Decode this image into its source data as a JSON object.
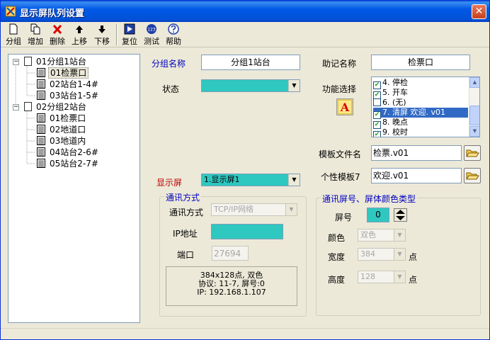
{
  "window": {
    "title": "显示屏队列设置",
    "close_glyph": "✕"
  },
  "toolbar": {
    "group": "分组",
    "add": "增加",
    "delete": "删除",
    "up": "上移",
    "down": "下移",
    "reset": "复位",
    "test": "测试",
    "help": "帮助",
    "test_badge": "123"
  },
  "tree": {
    "expander": "−",
    "groups": [
      {
        "label": "01分组1站台",
        "children": [
          "01检票口",
          "02站台1-4#",
          "03站台1-5#"
        ]
      },
      {
        "label": "02分组2站台",
        "children": [
          "01检票口",
          "02地道口",
          "03地道内",
          "04站台2-6#",
          "05站台2-7#"
        ]
      }
    ]
  },
  "form": {
    "group_name_label": "分组名称",
    "group_name_value": "分组1站台",
    "mnemonic_label": "助记名称",
    "mnemonic_value": "检票口",
    "status_label": "状态",
    "function_label": "功能选择",
    "function_items": [
      {
        "label": "4. 停检",
        "checked": true
      },
      {
        "label": "5. 开车",
        "checked": true
      },
      {
        "label": "6. (无)",
        "checked": false
      },
      {
        "label": "7. 清屏 欢迎. v01",
        "checked": true,
        "selected": true
      },
      {
        "label": "8. 晚点",
        "checked": true
      },
      {
        "label": "9. 校时",
        "checked": true
      }
    ],
    "font_icon_letter": "A",
    "template_file_label": "模板文件名",
    "template_file_value": "检票.v01",
    "personal_template_label": "个性模板7",
    "personal_template_value": "欢迎.v01",
    "display_label": "显示屏",
    "display_value": "1.显示屏1"
  },
  "comm": {
    "title": "通讯方式",
    "method_label": "通讯方式",
    "method_value": "TCP/IP网络",
    "ip_label": "IP地址",
    "port_label": "端口",
    "port_value": "27694",
    "info_lines": [
      "384x128点, 双色",
      "协议: 11-7, 屏号:0",
      "IP: 192.168.1.107"
    ]
  },
  "screen": {
    "title": "通讯屏号、屏体颜色类型",
    "number_label": "屏号",
    "number_value": "0",
    "color_label": "颜色",
    "color_value": "双色",
    "width_label": "宽度",
    "width_value": "384",
    "width_unit": "点",
    "height_label": "高度",
    "height_value": "128",
    "height_unit": "点"
  },
  "colors": {
    "accent_teal": "#2fc8c0",
    "title_blue": "#0058e6"
  }
}
